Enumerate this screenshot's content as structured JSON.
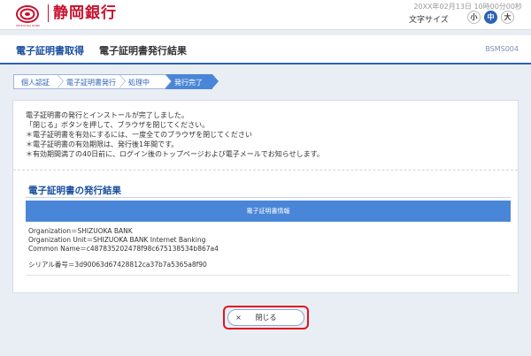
{
  "header": {
    "bank_name": "静岡銀行",
    "logo_subtext": "SHIZUOKA BANK",
    "datetime": "20XX年02月13日 10時00分00秒",
    "font_size_label": "文字サイズ",
    "font_size_small": "小",
    "font_size_medium": "中",
    "font_size_large": "大"
  },
  "titlebar": {
    "main": "電子証明書取得",
    "sub": "電子証明書発行結果",
    "screen_id": "BSMS004"
  },
  "steps": [
    {
      "label": "個人認証",
      "active": false
    },
    {
      "label": "電子証明書発行",
      "active": false
    },
    {
      "label": "処理中",
      "active": false
    },
    {
      "label": "発行完了",
      "active": true
    }
  ],
  "message": {
    "line1": "電子証明書の発行とインストールが完了しました。",
    "line2": "「閉じる」ボタンを押して、ブラウザを閉じてください。",
    "line3": "＊電子証明書を有効にするには、一度全てのブラウザを閉じてください",
    "line4": "＊電子証明書の有効期限は、発行後1年間です。",
    "line5": "＊有効期間満了の40日前に、ログイン後のトップページおよび電子メールでお知らせします。"
  },
  "result": {
    "section_title": "電子証明書の発行結果",
    "table_header": "電子証明書情報",
    "organization": "Organization＝SHIZUOKA BANK",
    "organization_unit": "Organization Unit＝SHIZUOKA BANK Internet Banking",
    "common_name": "Common Name＝c487835202478f98c675138534b867a4",
    "serial": "シリアル番号＝3d90063d67428812ca37b7a5365a8f90"
  },
  "actions": {
    "close_label": "閉じる",
    "close_icon": "×"
  },
  "colors": {
    "brand_red": "#c8102e",
    "accent_blue": "#2b63b5",
    "highlight_red": "#e0141e"
  }
}
